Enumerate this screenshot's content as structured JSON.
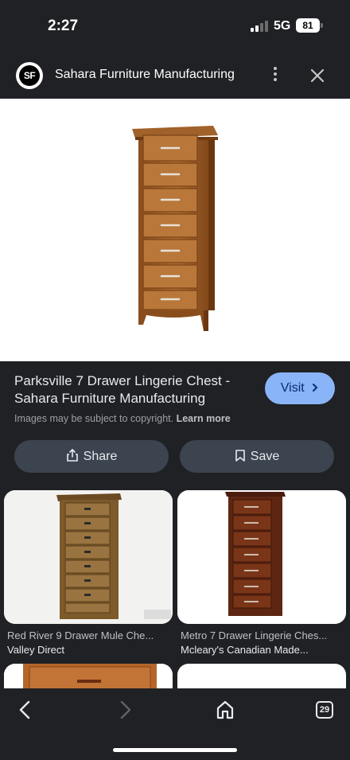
{
  "status": {
    "time": "2:27",
    "network": "5G",
    "battery": "81"
  },
  "header": {
    "logo_text": "SF",
    "site_name": "Sahara Furniture Manufacturing"
  },
  "product": {
    "title": "Parksville 7 Drawer Lingerie Chest - Sahara Furniture Manufacturing",
    "visit_label": "Visit",
    "copyright_text": "Images may be subject to copyright.",
    "learn_more": "Learn more"
  },
  "actions": {
    "share_label": "Share",
    "save_label": "Save"
  },
  "related": [
    {
      "title": "Red River 9 Drawer Mule Che...",
      "source": "Valley Direct"
    },
    {
      "title": "Metro 7 Drawer Lingerie Ches...",
      "source": "Mcleary's Canadian Made..."
    }
  ],
  "bottom_nav": {
    "tab_count": "29"
  },
  "colors": {
    "background": "#202124",
    "accent": "#8ab4f8",
    "button": "#3c4450"
  }
}
